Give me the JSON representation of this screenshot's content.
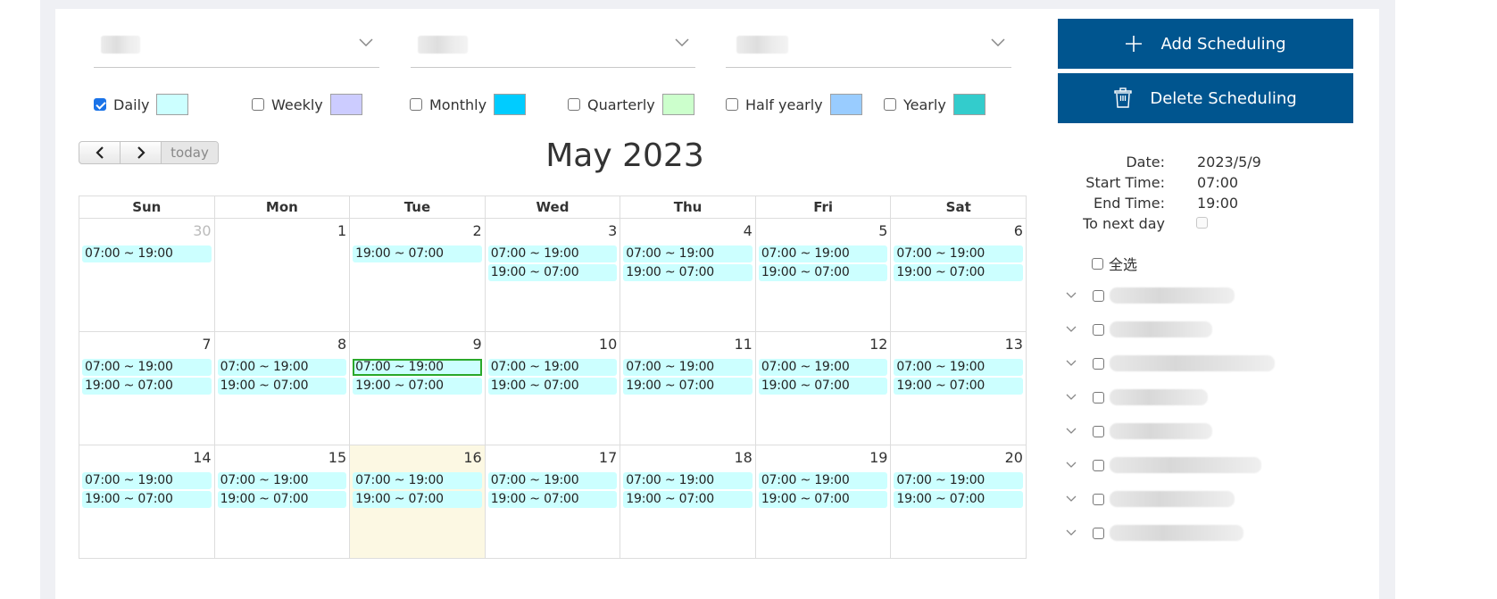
{
  "filters": {
    "select_1": {
      "value": "",
      "redacted": true
    },
    "select_2": {
      "value": "",
      "redacted": true
    },
    "select_3": {
      "value": "",
      "redacted": true
    }
  },
  "legend": [
    {
      "label": "Daily",
      "checked": true,
      "color": "#ccffff"
    },
    {
      "label": "Weekly",
      "checked": false,
      "color": "#ccccff"
    },
    {
      "label": "Monthly",
      "checked": false,
      "color": "#00ccff"
    },
    {
      "label": "Quarterly",
      "checked": false,
      "color": "#ccffcc"
    },
    {
      "label": "Half yearly",
      "checked": false,
      "color": "#99ccff"
    },
    {
      "label": "Yearly",
      "checked": false,
      "color": "#33cccc"
    }
  ],
  "actions": {
    "add_label": "Add Scheduling",
    "delete_label": "Delete Scheduling",
    "color": "#00558f"
  },
  "calendar": {
    "title": "May 2023",
    "today_label": "today",
    "prev_icon": "chevron-left-icon",
    "next_icon": "chevron-right-icon",
    "weekdays": [
      "Sun",
      "Mon",
      "Tue",
      "Wed",
      "Thu",
      "Fri",
      "Sat"
    ],
    "weeks": [
      [
        {
          "day": "30",
          "other_month": true,
          "events": [
            "07:00 ~ 19:00"
          ]
        },
        {
          "day": "1",
          "events": []
        },
        {
          "day": "2",
          "events": [
            "19:00 ~ 07:00"
          ]
        },
        {
          "day": "3",
          "events": [
            "07:00 ~ 19:00",
            "19:00 ~ 07:00"
          ]
        },
        {
          "day": "4",
          "events": [
            "07:00 ~ 19:00",
            "19:00 ~ 07:00"
          ]
        },
        {
          "day": "5",
          "events": [
            "07:00 ~ 19:00",
            "19:00 ~ 07:00"
          ]
        },
        {
          "day": "6",
          "events": [
            "07:00 ~ 19:00",
            "19:00 ~ 07:00"
          ]
        }
      ],
      [
        {
          "day": "7",
          "events": [
            "07:00 ~ 19:00",
            "19:00 ~ 07:00"
          ]
        },
        {
          "day": "8",
          "events": [
            "07:00 ~ 19:00",
            "19:00 ~ 07:00"
          ]
        },
        {
          "day": "9",
          "events": [
            "07:00 ~ 19:00",
            "19:00 ~ 07:00"
          ],
          "selected_event": 0
        },
        {
          "day": "10",
          "events": [
            "07:00 ~ 19:00",
            "19:00 ~ 07:00"
          ]
        },
        {
          "day": "11",
          "events": [
            "07:00 ~ 19:00",
            "19:00 ~ 07:00"
          ]
        },
        {
          "day": "12",
          "events": [
            "07:00 ~ 19:00",
            "19:00 ~ 07:00"
          ]
        },
        {
          "day": "13",
          "events": [
            "07:00 ~ 19:00",
            "19:00 ~ 07:00"
          ]
        }
      ],
      [
        {
          "day": "14",
          "events": [
            "07:00 ~ 19:00",
            "19:00 ~ 07:00"
          ]
        },
        {
          "day": "15",
          "events": [
            "07:00 ~ 19:00",
            "19:00 ~ 07:00"
          ]
        },
        {
          "day": "16",
          "today": true,
          "events": [
            "07:00 ~ 19:00",
            "19:00 ~ 07:00"
          ]
        },
        {
          "day": "17",
          "events": [
            "07:00 ~ 19:00",
            "19:00 ~ 07:00"
          ]
        },
        {
          "day": "18",
          "events": [
            "07:00 ~ 19:00",
            "19:00 ~ 07:00"
          ]
        },
        {
          "day": "19",
          "events": [
            "07:00 ~ 19:00",
            "19:00 ~ 07:00"
          ]
        },
        {
          "day": "20",
          "events": [
            "07:00 ~ 19:00",
            "19:00 ~ 07:00"
          ]
        }
      ]
    ]
  },
  "details": {
    "date_label": "Date:",
    "date_value": "2023/5/9",
    "start_label": "Start Time:",
    "start_value": "07:00",
    "end_label": "End Time:",
    "end_value": "19:00",
    "next_day_label": "To next day",
    "next_day_checked": false
  },
  "tree": {
    "select_all_label": "全选",
    "items": [
      {
        "label": "",
        "redacted": true,
        "checked": false
      },
      {
        "label": "",
        "redacted": true,
        "checked": false
      },
      {
        "label": "",
        "redacted": true,
        "checked": false
      },
      {
        "label": "",
        "redacted": true,
        "checked": false
      },
      {
        "label": "",
        "redacted": true,
        "checked": false
      },
      {
        "label": "",
        "redacted": true,
        "checked": false
      },
      {
        "label": "",
        "redacted": true,
        "checked": false
      },
      {
        "label": "",
        "redacted": true,
        "checked": false
      }
    ]
  }
}
